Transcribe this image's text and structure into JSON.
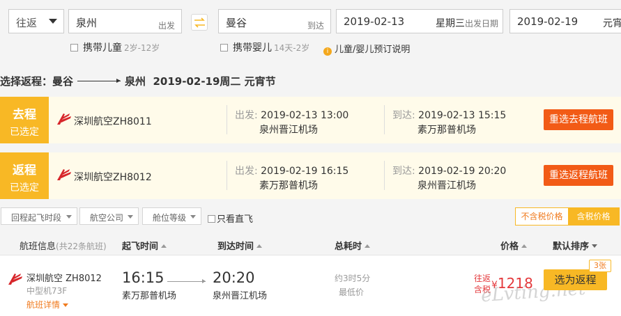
{
  "search": {
    "trip_type": "往返",
    "from_city": "泉州",
    "from_tag": "出发",
    "to_city": "曼谷",
    "to_tag": "到达",
    "depart_date": "2019-02-13",
    "depart_weekday": "星期三",
    "depart_date_tag": "出发日期",
    "return_date": "2019-02-19",
    "return_weekday": "元宵",
    "with_child": "携带儿童",
    "child_age": "2岁-12岁",
    "with_infant": "携带婴儿",
    "infant_age": "14天-2岁",
    "booking_note": "儿童/婴儿预订说明"
  },
  "return_title": {
    "prefix": "选择返程：曼谷",
    "dest": "泉州",
    "date": "2019-02-19周二 元宵节"
  },
  "legs": [
    {
      "tag": "去程",
      "status": "已选定",
      "flight": "深圳航空ZH8011",
      "depart_label": "出发:",
      "depart_time": "2019-02-13 13:00",
      "depart_airport": "泉州晋江机场",
      "arrive_label": "到达:",
      "arrive_time": "2019-02-13 15:15",
      "arrive_airport": "素万那普机场",
      "button": "重选去程航班"
    },
    {
      "tag": "返程",
      "status": "已选定",
      "flight": "深圳航空ZH8012",
      "depart_label": "出发:",
      "depart_time": "2019-02-19 16:15",
      "depart_airport": "素万那普机场",
      "arrive_label": "到达:",
      "arrive_time": "2019-02-19 20:20",
      "arrive_airport": "泉州晋江机场",
      "button": "重选返程航班"
    }
  ],
  "filters": {
    "time": "回程起飞时段",
    "airline": "航空公司",
    "cabin": "舱位等级",
    "direct_only": "只看直飞",
    "price_no_tax": "不含税价格",
    "price_with_tax": "含税价格"
  },
  "columns": {
    "info": "航班信息",
    "count": "(共22条航班)",
    "depart": "起飞时间",
    "arrive": "到达时间",
    "duration": "总耗时",
    "price": "价格",
    "sort": "默认排序"
  },
  "result": {
    "airline_flight": "深圳航空 ZH8012",
    "plane": "中型机73F",
    "details": "航班详情",
    "depart_time": "16:15",
    "depart_airport": "素万那普机场",
    "arrive_time": "20:20",
    "arrive_airport": "泉州晋江机场",
    "duration": "约3时5分",
    "lowest": "最低价",
    "price_label_1": "往返",
    "price_label_2": "含税",
    "currency": "¥",
    "price": "1218",
    "choose": "选为返程",
    "seats": "3张"
  },
  "watermark": "eLvting.net",
  "colors": {
    "accent_yellow": "#f8b825",
    "button_orange": "#f25b16",
    "price_red": "#e4393c",
    "link_orange": "#f07b1f"
  }
}
